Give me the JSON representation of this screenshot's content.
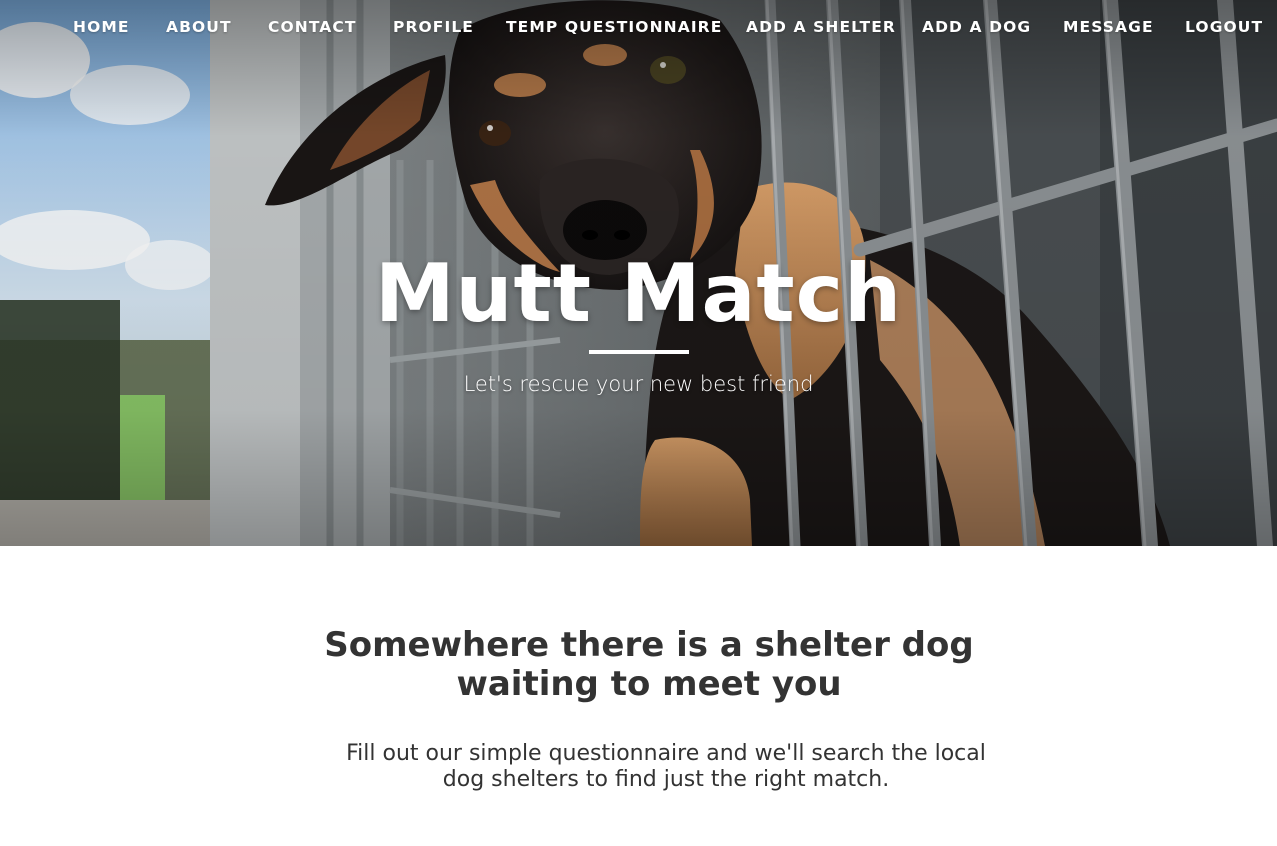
{
  "nav": {
    "items": [
      {
        "label": "HOME"
      },
      {
        "label": "ABOUT"
      },
      {
        "label": "CONTACT"
      },
      {
        "label": "PROFILE"
      },
      {
        "label": "TEMP QUESTIONNAIRE"
      },
      {
        "label": "ADD A SHELTER"
      },
      {
        "label": "ADD A DOG"
      },
      {
        "label": "MESSAGE"
      },
      {
        "label": "LOGOUT"
      }
    ]
  },
  "hero": {
    "title": "Mutt Match",
    "subtitle": "Let's rescue your new best friend",
    "image_description": "dog-behind-kennel-bars-photo"
  },
  "content": {
    "heading": "Somewhere there is a shelter dog waiting to meet you",
    "text": "Fill out our simple questionnaire and we'll search the local dog shelters to find just the right match."
  },
  "colors": {
    "nav_text": "#ffffff",
    "heading_text": "#333333",
    "body_text": "#333333",
    "page_background": "#ffffff"
  }
}
